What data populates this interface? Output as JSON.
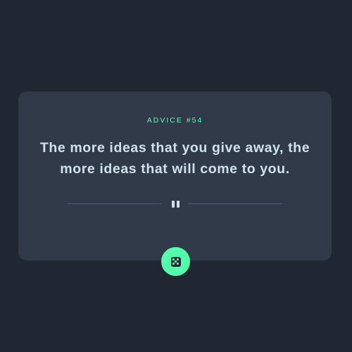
{
  "advice": {
    "label": "ADVICE #54",
    "text": "The more ideas that you give away, the more ideas that will come to you."
  },
  "divider": {
    "icon": "pause-icon"
  },
  "dice_button": {
    "icon": "dice-icon"
  },
  "colors": {
    "background": "#202733",
    "card": "#313a48",
    "accent": "#53ffaa",
    "text": "#cee3e9",
    "divider": "#4f5d74"
  }
}
